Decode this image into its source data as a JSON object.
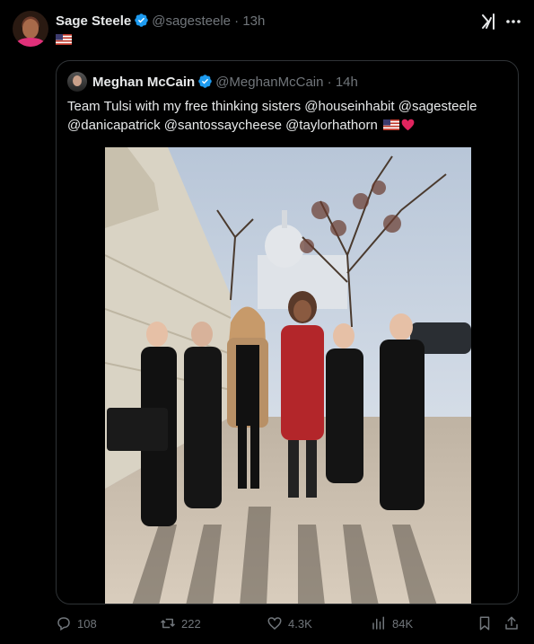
{
  "tweet": {
    "author_name": "Sage Steele",
    "author_handle": "@sagesteele",
    "separator": " · ",
    "time": "13h"
  },
  "quoted": {
    "author_name": "Meghan McCain",
    "author_handle": "@MeghanMcCain",
    "separator": " · ",
    "time": "14h",
    "text_line1": "Team Tulsi with my free thinking sisters @houseinhabit @sagesteele",
    "text_line2": "@danicapatrick @santossaycheese @taylorhathorn",
    "image_desc": "photo-of-six-women-in-front-of-capitol"
  },
  "actions": {
    "replies": "108",
    "reposts": "222",
    "likes": "4.3K",
    "views": "84K"
  },
  "icons": {
    "verified": "verified-badge-icon",
    "grok": "grok-icon",
    "more": "more-icon",
    "reply": "reply-icon",
    "repost": "repost-icon",
    "like": "like-icon",
    "views": "views-icon",
    "bookmark": "bookmark-icon",
    "share": "share-icon"
  },
  "colors": {
    "background": "#000000",
    "text": "#e7e9ea",
    "muted": "#71767b",
    "verified": "#1d9bf0",
    "heart": "#e0245e"
  }
}
